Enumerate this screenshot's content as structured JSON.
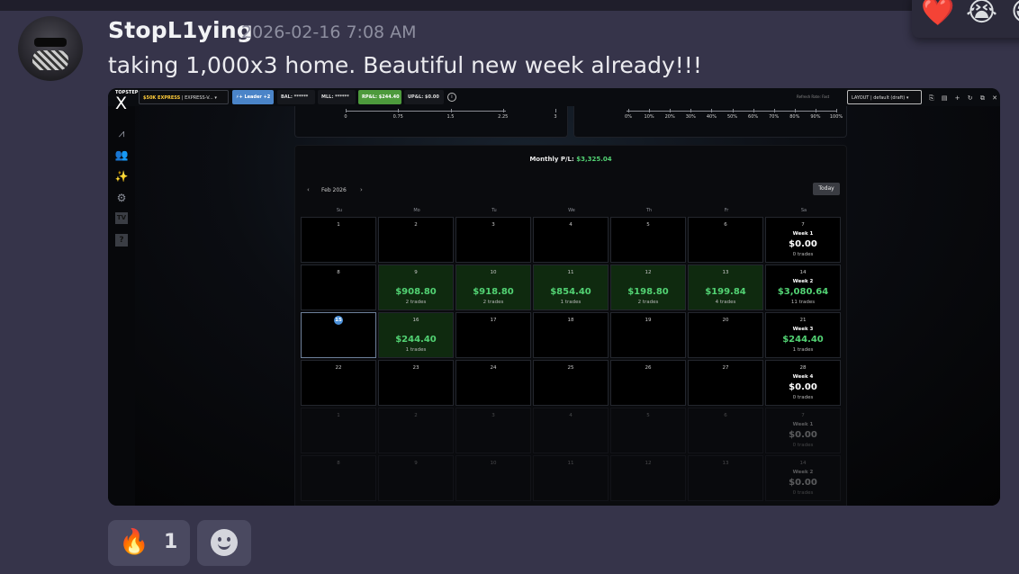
{
  "chat": {
    "username": "StopL1ying",
    "timestamp": "2026-02-16 7:08 AM",
    "message": "taking 1,000x3 home. Beautiful new week already!!!",
    "quick_reactions": [
      "❤️",
      "😭",
      "😄"
    ]
  },
  "reactions": [
    {
      "emoji": "🔥",
      "count": "1"
    }
  ],
  "add_reaction_icon": "smiley-add-reaction-icon",
  "screenshot": {
    "topbar": {
      "logo": "TOPSTEP",
      "account_main": "$50K EXPRESS",
      "account_sub": "EXPRESS-V...",
      "leader": "⚡+ Leader +2",
      "bal": "BAL: ******",
      "mll": "MLL: ******",
      "rpl": "RP&L: $244.40",
      "upl": "UP&L: $0.00",
      "info": "i",
      "refresh": "Refresh Rate: Fast",
      "layout": "LAYOUT | default (draft)",
      "window_icons": "⎘ ▤ + ↻ ⧉ ✕"
    },
    "sidebar": {
      "brand": "X",
      "icons": [
        "chart-icon",
        "users-icon",
        "magic-icon",
        "settings-icon",
        "tv-icon",
        "help-icon"
      ],
      "glyphs": [
        "⩘",
        "👥",
        "✨",
        "⚙",
        "TV",
        "?"
      ]
    },
    "panel_left_ticks": [
      "0",
      "0.75",
      "1.5",
      "2.25",
      "3"
    ],
    "panel_right_ticks": [
      "0%",
      "10%",
      "20%",
      "30%",
      "40%",
      "50%",
      "60%",
      "70%",
      "80%",
      "90%",
      "100%"
    ],
    "calendar": {
      "monthly_label": "Monthly P/L:",
      "monthly_value": "$3,325.04",
      "month": "Feb 2026",
      "prev": "‹",
      "next": "›",
      "today_label": "Today",
      "weekdays": [
        "Su",
        "Mo",
        "Tu",
        "We",
        "Th",
        "Fr",
        "Sa"
      ],
      "weeks": [
        {
          "days": [
            {
              "d": "1"
            },
            {
              "d": "2"
            },
            {
              "d": "3"
            },
            {
              "d": "4"
            },
            {
              "d": "5"
            },
            {
              "d": "6"
            }
          ],
          "summary": {
            "d": "7",
            "label": "Week 1",
            "pnl": "$0.00",
            "trades": "0 trades",
            "positive": false
          }
        },
        {
          "days": [
            {
              "d": "8"
            },
            {
              "d": "9",
              "pnl": "$908.80",
              "trades": "2 trades"
            },
            {
              "d": "10",
              "pnl": "$918.80",
              "trades": "2 trades"
            },
            {
              "d": "11",
              "pnl": "$854.40",
              "trades": "1 trades"
            },
            {
              "d": "12",
              "pnl": "$198.80",
              "trades": "2 trades"
            },
            {
              "d": "13",
              "pnl": "$199.84",
              "trades": "4 trades"
            }
          ],
          "summary": {
            "d": "14",
            "label": "Week 2",
            "pnl": "$3,080.64",
            "trades": "11 trades",
            "positive": true
          }
        },
        {
          "days": [
            {
              "d": "15",
              "today": true
            },
            {
              "d": "16",
              "pnl": "$244.40",
              "trades": "1 trades"
            },
            {
              "d": "17"
            },
            {
              "d": "18"
            },
            {
              "d": "19"
            },
            {
              "d": "20"
            }
          ],
          "summary": {
            "d": "21",
            "label": "Week 3",
            "pnl": "$244.40",
            "trades": "1 trades",
            "positive": true
          }
        },
        {
          "days": [
            {
              "d": "22"
            },
            {
              "d": "23"
            },
            {
              "d": "24"
            },
            {
              "d": "25"
            },
            {
              "d": "26"
            },
            {
              "d": "27"
            }
          ],
          "summary": {
            "d": "28",
            "label": "Week 4",
            "pnl": "$0.00",
            "trades": "0 trades",
            "positive": false
          }
        },
        {
          "dim": true,
          "days": [
            {
              "d": "1"
            },
            {
              "d": "2"
            },
            {
              "d": "3"
            },
            {
              "d": "4"
            },
            {
              "d": "5"
            },
            {
              "d": "6"
            }
          ],
          "summary": {
            "d": "7",
            "label": "Week 1",
            "pnl": "$0.00",
            "trades": "0 trades",
            "positive": false
          }
        },
        {
          "dim": true,
          "days": [
            {
              "d": "8"
            },
            {
              "d": "9"
            },
            {
              "d": "10"
            },
            {
              "d": "11"
            },
            {
              "d": "12"
            },
            {
              "d": "13"
            }
          ],
          "summary": {
            "d": "14",
            "label": "Week 2",
            "pnl": "$0.00",
            "trades": "0 trades",
            "positive": false
          }
        }
      ]
    }
  }
}
